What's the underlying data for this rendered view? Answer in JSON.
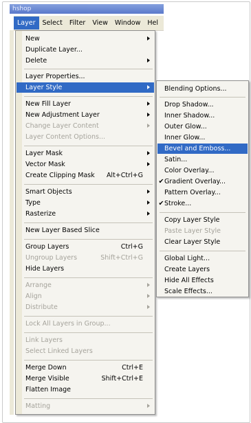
{
  "window": {
    "title": "Photoshop",
    "title_fragment": "hshop"
  },
  "menubar": {
    "items": [
      {
        "label": "Layer",
        "active": true
      },
      {
        "label": "Select"
      },
      {
        "label": "Filter"
      },
      {
        "label": "View"
      },
      {
        "label": "Window"
      },
      {
        "label": "Help"
      }
    ],
    "last_label_visible": "Hel"
  },
  "layer_menu": {
    "items": [
      {
        "label": "New",
        "submenu": true
      },
      {
        "label": "Duplicate Layer..."
      },
      {
        "label": "Delete",
        "submenu": true
      },
      {
        "label": "Layer Properties..."
      },
      {
        "label": "Layer Style",
        "submenu": true,
        "highlighted": true
      },
      {
        "label": "New Fill Layer",
        "submenu": true
      },
      {
        "label": "New Adjustment Layer",
        "submenu": true
      },
      {
        "label": "Change Layer Content",
        "submenu": true,
        "disabled": true
      },
      {
        "label": "Layer Content Options...",
        "disabled": true
      },
      {
        "label": "Layer Mask",
        "submenu": true
      },
      {
        "label": "Vector Mask",
        "submenu": true
      },
      {
        "label": "Create Clipping Mask",
        "shortcut": "Alt+Ctrl+G"
      },
      {
        "label": "Smart Objects",
        "submenu": true
      },
      {
        "label": "Type",
        "submenu": true
      },
      {
        "label": "Rasterize",
        "submenu": true
      },
      {
        "label": "New Layer Based Slice"
      },
      {
        "label": "Group Layers",
        "shortcut": "Ctrl+G"
      },
      {
        "label": "Ungroup Layers",
        "shortcut": "Shift+Ctrl+G",
        "disabled": true
      },
      {
        "label": "Hide Layers"
      },
      {
        "label": "Arrange",
        "submenu": true,
        "disabled": true
      },
      {
        "label": "Align",
        "submenu": true,
        "disabled": true
      },
      {
        "label": "Distribute",
        "submenu": true,
        "disabled": true
      },
      {
        "label": "Lock All Layers in Group...",
        "disabled": true
      },
      {
        "label": "Link Layers",
        "disabled": true
      },
      {
        "label": "Select Linked Layers",
        "disabled": true
      },
      {
        "label": "Merge Down",
        "shortcut": "Ctrl+E"
      },
      {
        "label": "Merge Visible",
        "shortcut": "Shift+Ctrl+E"
      },
      {
        "label": "Flatten Image"
      },
      {
        "label": "Matting",
        "submenu": true,
        "disabled": true
      }
    ]
  },
  "layer_style_submenu": {
    "items": [
      {
        "label": "Blending Options..."
      },
      {
        "label": "Drop Shadow..."
      },
      {
        "label": "Inner Shadow..."
      },
      {
        "label": "Outer Glow..."
      },
      {
        "label": "Inner Glow..."
      },
      {
        "label": "Bevel and Emboss...",
        "highlighted": true
      },
      {
        "label": "Satin..."
      },
      {
        "label": "Color Overlay..."
      },
      {
        "label": "Gradient Overlay...",
        "checked": true
      },
      {
        "label": "Pattern Overlay..."
      },
      {
        "label": "Stroke...",
        "checked": true
      },
      {
        "label": "Copy Layer Style"
      },
      {
        "label": "Paste Layer Style",
        "disabled": true
      },
      {
        "label": "Clear Layer Style"
      },
      {
        "label": "Global Light..."
      },
      {
        "label": "Create Layers"
      },
      {
        "label": "Hide All Effects"
      },
      {
        "label": "Scale Effects..."
      }
    ],
    "check_glyph": "✔"
  },
  "colors": {
    "highlight": "#316ac5",
    "disabled_text": "#a5a39b",
    "menu_bg": "#f5f4ef"
  }
}
